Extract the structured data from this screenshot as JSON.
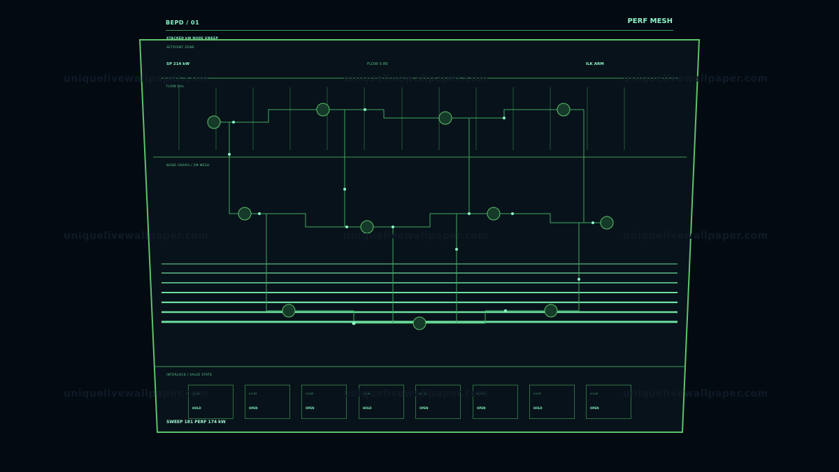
{
  "header": {
    "doc_id": "BEPD / 01",
    "title": "PERF MESH"
  },
  "sweep": {
    "label": "STACKED kW NODE SWEEP"
  },
  "setpoint": {
    "label": "SETPOINT ZONE",
    "sp": "SP 214 kW",
    "flow": "FLOW 0.86",
    "ilk": "ILK ARM"
  },
  "flow_bal": {
    "label": "FLOW BAL"
  },
  "node_graph": {
    "label": "NODE GRAPH / 2M MESH"
  },
  "interlock": {
    "label": "INTERLOCK / VALVE STATE"
  },
  "valves": [
    {
      "id": "V-0.00",
      "state": "HOLD"
    },
    {
      "id": "V-0.03",
      "state": "OPEN"
    },
    {
      "id": "V-0.05",
      "state": "OPEN"
    },
    {
      "id": "V-0.08",
      "state": "HOLD"
    },
    {
      "id": "V-0.20",
      "state": "OPEN"
    },
    {
      "id": "V-0.50",
      "state": "OPEN"
    },
    {
      "id": "V-0.97",
      "state": "HOLD"
    },
    {
      "id": "V-0.40",
      "state": "OPEN"
    }
  ],
  "footer": {
    "summary": "SWEEP 181 PERF 174 kW"
  },
  "watermark": "uniquelivewallpaper.com",
  "colors": {
    "panel_border": "#5ec46a",
    "trace": "#3faa62",
    "accent": "#8ef5c8"
  }
}
